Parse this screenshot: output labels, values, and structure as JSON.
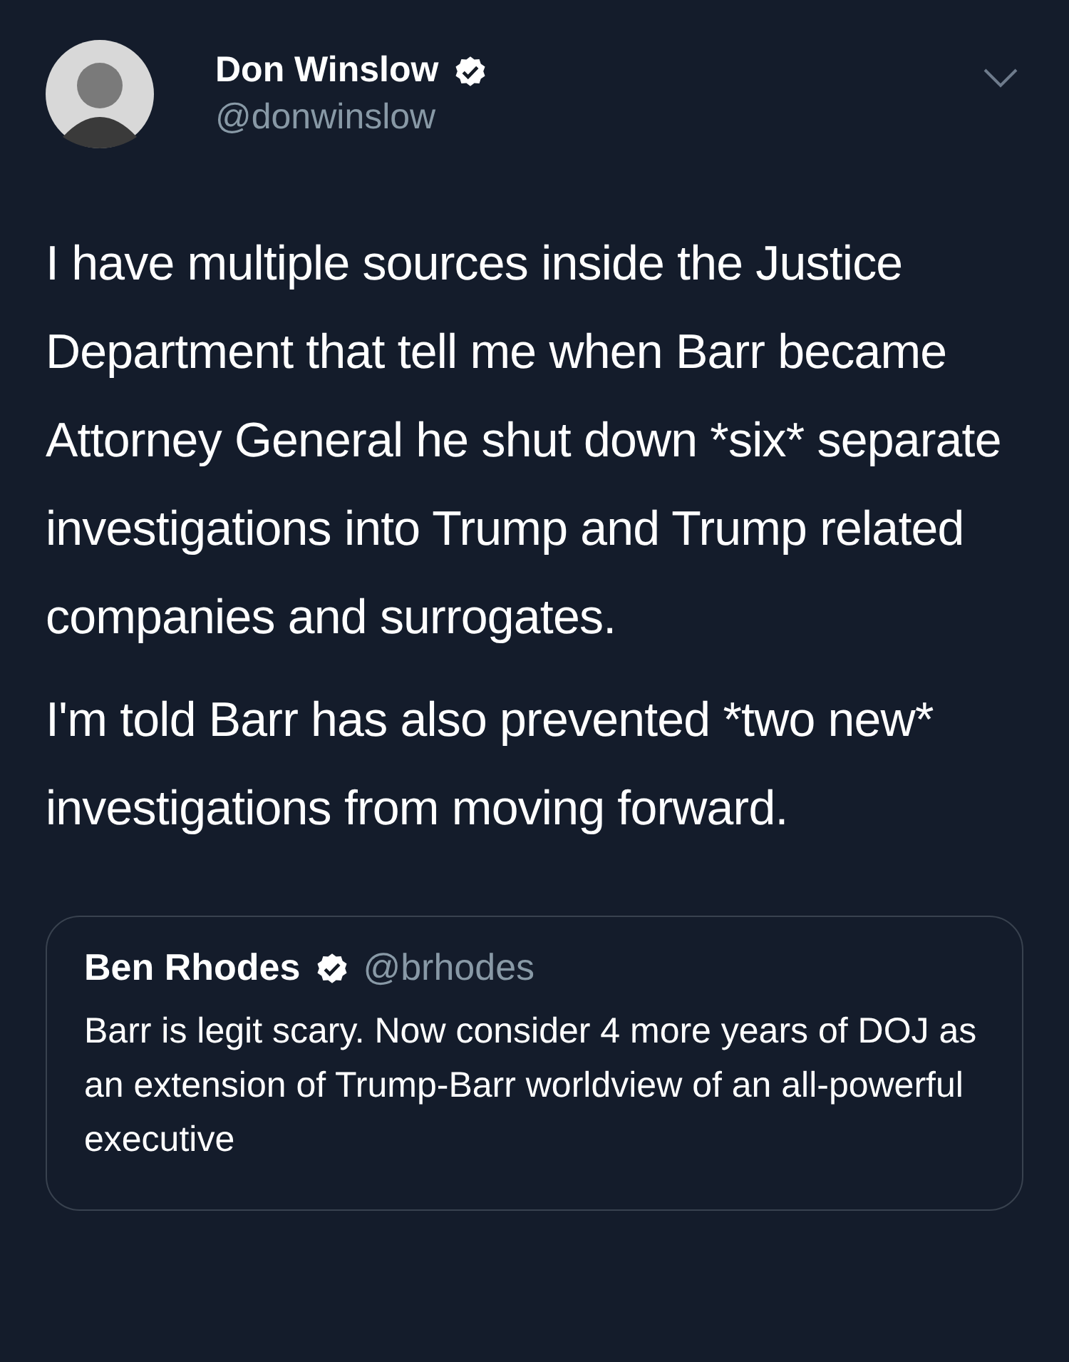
{
  "tweet": {
    "author": {
      "name": "Don Winslow",
      "handle": "@donwinslow"
    },
    "paragraphs": [
      "I have multiple sources inside the Justice Department that tell me when Barr became Attorney General he shut down *six* separate investigations into Trump and Trump related companies and surrogates.",
      "I'm told Barr has also prevented *two new* investigations from moving forward."
    ],
    "quoted_tweet": {
      "author": {
        "name": "Ben Rhodes",
        "handle": "@brhodes"
      },
      "text": "Barr is legit scary. Now consider 4 more years of DOJ as an extension of Trump-Barr worldview of an all-powerful executive"
    }
  }
}
